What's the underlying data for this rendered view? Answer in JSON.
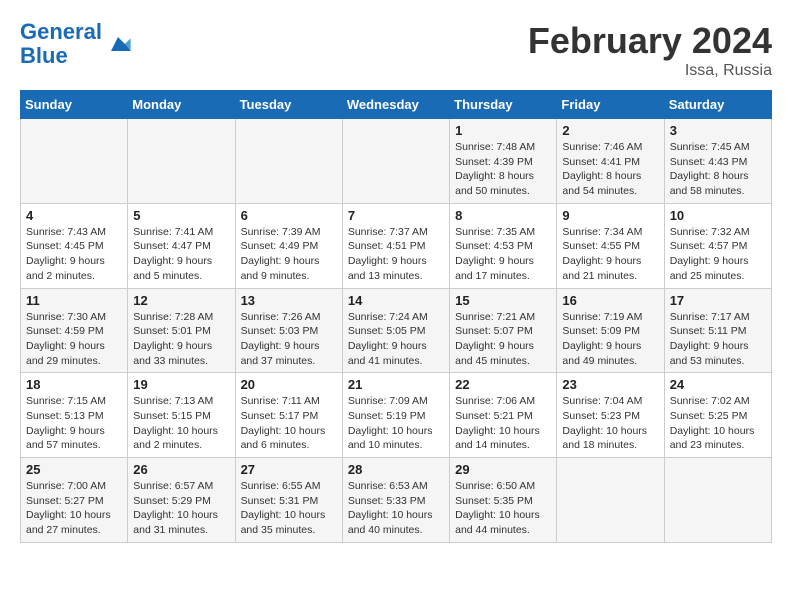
{
  "logo": {
    "line1": "General",
    "line2": "Blue"
  },
  "title": "February 2024",
  "location": "Issa, Russia",
  "weekdays": [
    "Sunday",
    "Monday",
    "Tuesday",
    "Wednesday",
    "Thursday",
    "Friday",
    "Saturday"
  ],
  "weeks": [
    [
      {
        "day": "",
        "info": ""
      },
      {
        "day": "",
        "info": ""
      },
      {
        "day": "",
        "info": ""
      },
      {
        "day": "",
        "info": ""
      },
      {
        "day": "1",
        "info": "Sunrise: 7:48 AM\nSunset: 4:39 PM\nDaylight: 8 hours\nand 50 minutes."
      },
      {
        "day": "2",
        "info": "Sunrise: 7:46 AM\nSunset: 4:41 PM\nDaylight: 8 hours\nand 54 minutes."
      },
      {
        "day": "3",
        "info": "Sunrise: 7:45 AM\nSunset: 4:43 PM\nDaylight: 8 hours\nand 58 minutes."
      }
    ],
    [
      {
        "day": "4",
        "info": "Sunrise: 7:43 AM\nSunset: 4:45 PM\nDaylight: 9 hours\nand 2 minutes."
      },
      {
        "day": "5",
        "info": "Sunrise: 7:41 AM\nSunset: 4:47 PM\nDaylight: 9 hours\nand 5 minutes."
      },
      {
        "day": "6",
        "info": "Sunrise: 7:39 AM\nSunset: 4:49 PM\nDaylight: 9 hours\nand 9 minutes."
      },
      {
        "day": "7",
        "info": "Sunrise: 7:37 AM\nSunset: 4:51 PM\nDaylight: 9 hours\nand 13 minutes."
      },
      {
        "day": "8",
        "info": "Sunrise: 7:35 AM\nSunset: 4:53 PM\nDaylight: 9 hours\nand 17 minutes."
      },
      {
        "day": "9",
        "info": "Sunrise: 7:34 AM\nSunset: 4:55 PM\nDaylight: 9 hours\nand 21 minutes."
      },
      {
        "day": "10",
        "info": "Sunrise: 7:32 AM\nSunset: 4:57 PM\nDaylight: 9 hours\nand 25 minutes."
      }
    ],
    [
      {
        "day": "11",
        "info": "Sunrise: 7:30 AM\nSunset: 4:59 PM\nDaylight: 9 hours\nand 29 minutes."
      },
      {
        "day": "12",
        "info": "Sunrise: 7:28 AM\nSunset: 5:01 PM\nDaylight: 9 hours\nand 33 minutes."
      },
      {
        "day": "13",
        "info": "Sunrise: 7:26 AM\nSunset: 5:03 PM\nDaylight: 9 hours\nand 37 minutes."
      },
      {
        "day": "14",
        "info": "Sunrise: 7:24 AM\nSunset: 5:05 PM\nDaylight: 9 hours\nand 41 minutes."
      },
      {
        "day": "15",
        "info": "Sunrise: 7:21 AM\nSunset: 5:07 PM\nDaylight: 9 hours\nand 45 minutes."
      },
      {
        "day": "16",
        "info": "Sunrise: 7:19 AM\nSunset: 5:09 PM\nDaylight: 9 hours\nand 49 minutes."
      },
      {
        "day": "17",
        "info": "Sunrise: 7:17 AM\nSunset: 5:11 PM\nDaylight: 9 hours\nand 53 minutes."
      }
    ],
    [
      {
        "day": "18",
        "info": "Sunrise: 7:15 AM\nSunset: 5:13 PM\nDaylight: 9 hours\nand 57 minutes."
      },
      {
        "day": "19",
        "info": "Sunrise: 7:13 AM\nSunset: 5:15 PM\nDaylight: 10 hours\nand 2 minutes."
      },
      {
        "day": "20",
        "info": "Sunrise: 7:11 AM\nSunset: 5:17 PM\nDaylight: 10 hours\nand 6 minutes."
      },
      {
        "day": "21",
        "info": "Sunrise: 7:09 AM\nSunset: 5:19 PM\nDaylight: 10 hours\nand 10 minutes."
      },
      {
        "day": "22",
        "info": "Sunrise: 7:06 AM\nSunset: 5:21 PM\nDaylight: 10 hours\nand 14 minutes."
      },
      {
        "day": "23",
        "info": "Sunrise: 7:04 AM\nSunset: 5:23 PM\nDaylight: 10 hours\nand 18 minutes."
      },
      {
        "day": "24",
        "info": "Sunrise: 7:02 AM\nSunset: 5:25 PM\nDaylight: 10 hours\nand 23 minutes."
      }
    ],
    [
      {
        "day": "25",
        "info": "Sunrise: 7:00 AM\nSunset: 5:27 PM\nDaylight: 10 hours\nand 27 minutes."
      },
      {
        "day": "26",
        "info": "Sunrise: 6:57 AM\nSunset: 5:29 PM\nDaylight: 10 hours\nand 31 minutes."
      },
      {
        "day": "27",
        "info": "Sunrise: 6:55 AM\nSunset: 5:31 PM\nDaylight: 10 hours\nand 35 minutes."
      },
      {
        "day": "28",
        "info": "Sunrise: 6:53 AM\nSunset: 5:33 PM\nDaylight: 10 hours\nand 40 minutes."
      },
      {
        "day": "29",
        "info": "Sunrise: 6:50 AM\nSunset: 5:35 PM\nDaylight: 10 hours\nand 44 minutes."
      },
      {
        "day": "",
        "info": ""
      },
      {
        "day": "",
        "info": ""
      }
    ]
  ]
}
